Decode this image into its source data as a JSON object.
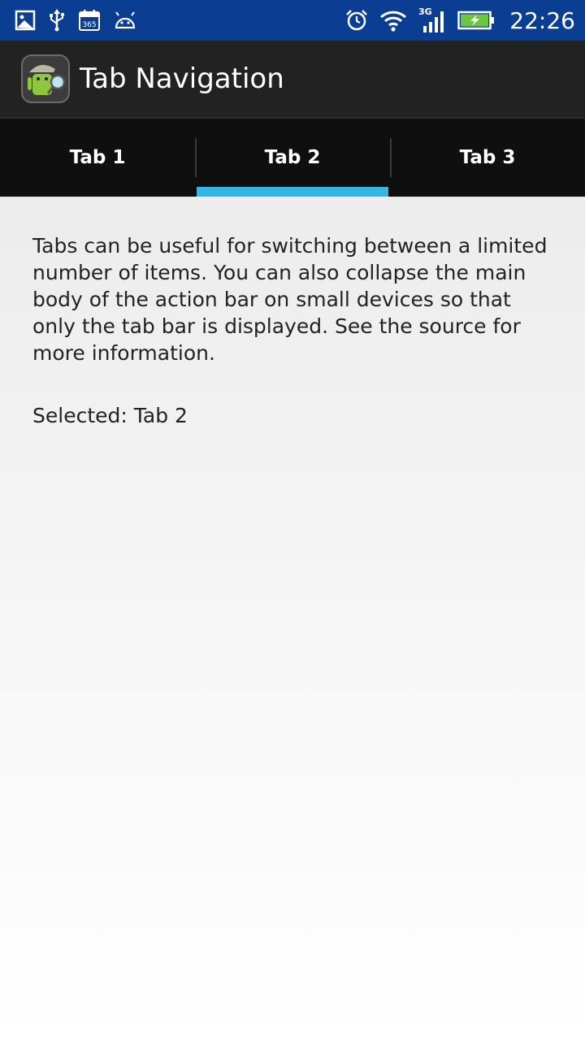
{
  "status_bar": {
    "time": "22:26",
    "network_type": "3G",
    "left_icons": [
      "image-icon",
      "usb-icon",
      "calendar-365-icon",
      "android-icon"
    ],
    "right_icons": [
      "alarm-icon",
      "wifi-icon",
      "signal-icon",
      "battery-charging-icon"
    ],
    "calendar_label": "365"
  },
  "action_bar": {
    "title": "Tab Navigation",
    "icon": "android-detective-icon"
  },
  "tabs": [
    {
      "label": "Tab 1",
      "selected": false
    },
    {
      "label": "Tab 2",
      "selected": true
    },
    {
      "label": "Tab 3",
      "selected": false
    }
  ],
  "content": {
    "description": "Tabs can be useful for switching between a limited number of items. You can also collapse the main body of the action bar on small devices so that only the tab bar is displayed. See the source for more information.",
    "selected_text": "Selected: Tab 2"
  },
  "colors": {
    "status_bar": "#0b3d93",
    "action_bar": "#222222",
    "tab_bar": "#0f0f0f",
    "tab_indicator": "#33b5e5",
    "battery": "#6cc644"
  }
}
